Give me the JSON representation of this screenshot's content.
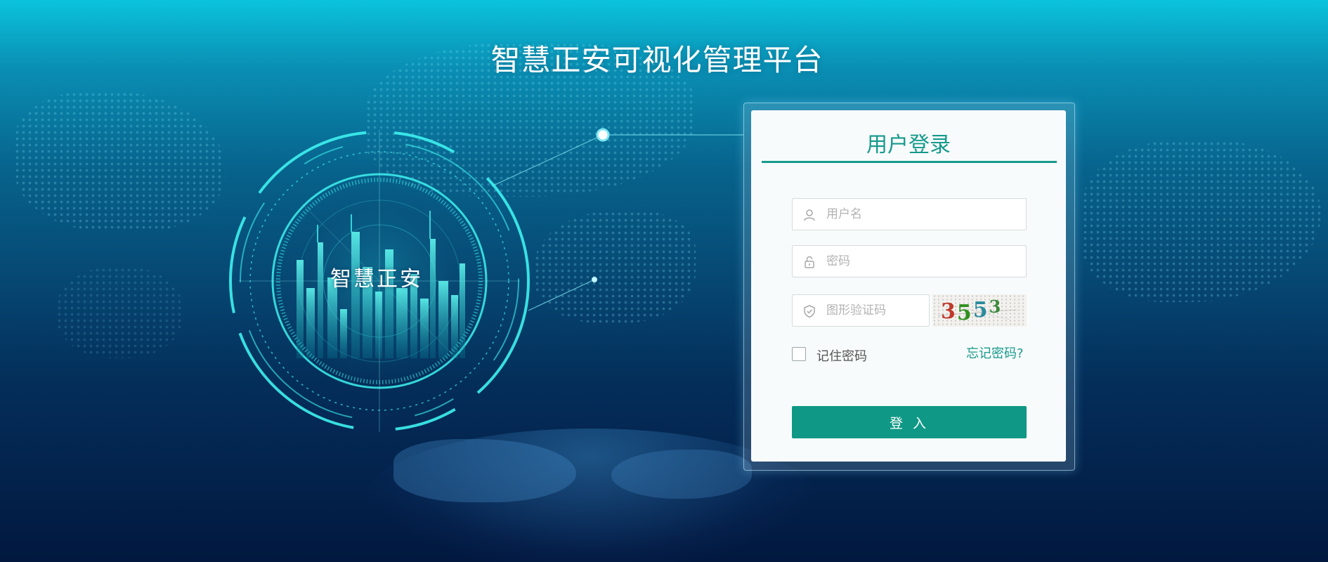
{
  "header": {
    "title": "智慧正安可视化管理平台"
  },
  "emblem": {
    "label": "智慧正安"
  },
  "login": {
    "title": "用户登录",
    "username_placeholder": "用户名",
    "password_placeholder": "密码",
    "captcha_placeholder": "图形验证码",
    "captcha_code": "3553",
    "remember_label": "记住密码",
    "remember_checked": false,
    "forgot_label": "忘记密码?",
    "submit_label": "登 入"
  },
  "icons": {
    "username": "user-icon",
    "password": "lock-icon",
    "captcha": "shield-icon"
  },
  "colors": {
    "accent": "#169a8c",
    "button": "#0f9886",
    "glow": "#3ef2f0",
    "background_top": "#0bc3dc",
    "background_bottom": "#02183f"
  }
}
